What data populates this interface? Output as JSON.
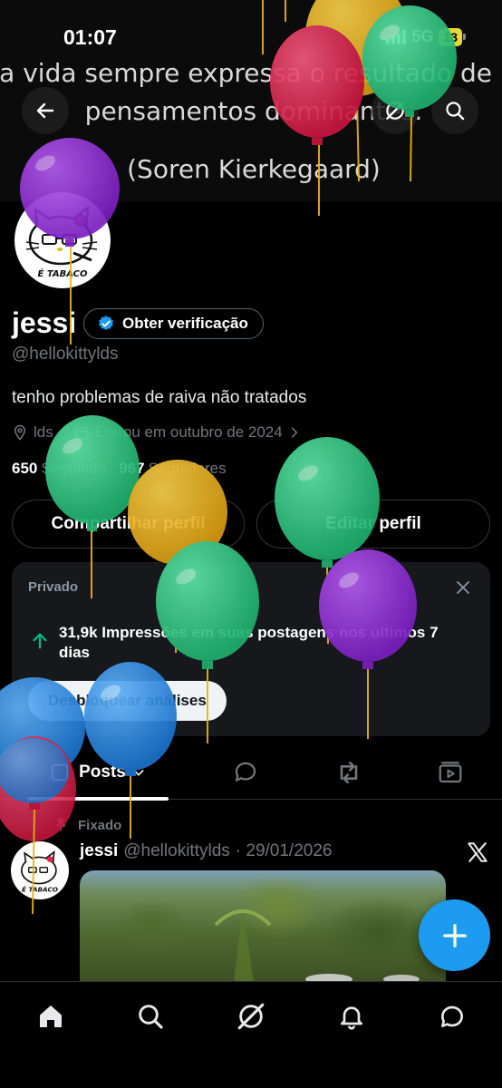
{
  "status_bar": {
    "time": "01:07",
    "network": "5G",
    "battery": "13"
  },
  "banner": {
    "quote_line1": "ssa vida sempre expressa o resultado de nos",
    "quote_line2": "pensamentos dominantes.",
    "quote_line3": "(Soren Kierkegaard)"
  },
  "profile": {
    "name": "jessi",
    "verify_label": "Obter verificação",
    "handle": "@hellokittylds",
    "bio": "tenho problemas de raiva não tratados",
    "location": "lds",
    "joined": "Entrou em outubro de 2024",
    "following_count": "650",
    "following_label": "Seguindo",
    "followers_count": "967",
    "followers_label": "Seguidores",
    "share_label": "Compartilhar perfil",
    "edit_label": "Editar perfil",
    "avatar_caption": "É TABACO"
  },
  "analytics": {
    "private_label": "Privado",
    "stat_text": "31,9k Impressões em suas postagens nos últimos 7 dias",
    "unlock_label": "Desbloquear análises"
  },
  "tabs": {
    "posts_label": "Posts"
  },
  "post": {
    "pinned_label": "Fixado",
    "author": "jessi",
    "handle": "@hellokittylds",
    "date": "· 29/01/2026"
  },
  "colors": {
    "accent": "#1d9bf0",
    "balloon_colors": [
      "#8e2bd1",
      "#2ecc86",
      "#e8b31a",
      "#e8244f",
      "#2b8fe3"
    ]
  }
}
